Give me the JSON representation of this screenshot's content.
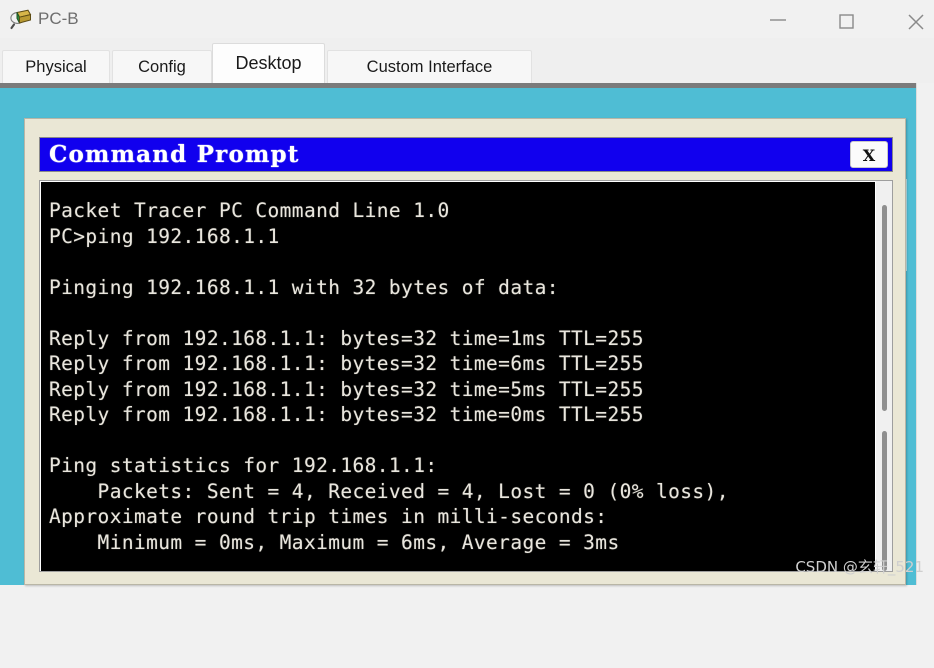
{
  "window": {
    "title": "PC-B",
    "icon": "packet-tracer-pc-icon",
    "controls": {
      "minimize_label": "—",
      "maximize_label": "□",
      "close_label": "✕"
    }
  },
  "tabs": [
    {
      "label": "Physical",
      "active": false
    },
    {
      "label": "Config",
      "active": false
    },
    {
      "label": "Desktop",
      "active": true
    },
    {
      "label": "Custom Interface",
      "active": false
    }
  ],
  "desktop": {
    "background_color": "#4fbdd4",
    "tiles": [
      {
        "icon": "ip-configuration-icon"
      },
      {
        "icon": "dial-up-icon"
      },
      {
        "icon": "terminal-icon"
      },
      {
        "icon": "command-prompt-icon"
      },
      {
        "icon": "web-browser-icon"
      }
    ]
  },
  "command_prompt": {
    "title": "Command Prompt",
    "title_bar_color": "#1100ee",
    "close_button_label": "X",
    "terminal": {
      "background_color": "#000000",
      "text_color": "#e9e6de",
      "lines": [
        "Packet Tracer PC Command Line 1.0",
        "PC>ping 192.168.1.1",
        "",
        "Pinging 192.168.1.1 with 32 bytes of data:",
        "",
        "Reply from 192.168.1.1: bytes=32 time=1ms TTL=255",
        "Reply from 192.168.1.1: bytes=32 time=6ms TTL=255",
        "Reply from 192.168.1.1: bytes=32 time=5ms TTL=255",
        "Reply from 192.168.1.1: bytes=32 time=0ms TTL=255",
        "",
        "Ping statistics for 192.168.1.1:",
        "    Packets: Sent = 4, Received = 4, Lost = 0 (0% loss),",
        "Approximate round trip times in milli-seconds:",
        "    Minimum = 0ms, Maximum = 6ms, Average = 3ms"
      ],
      "ping_summary": {
        "target": "192.168.1.1",
        "bytes": 32,
        "sent": 4,
        "received": 4,
        "lost": 0,
        "loss_percent": 0,
        "minimum_ms": 0,
        "maximum_ms": 6,
        "average_ms": 3,
        "ttl": 255,
        "reply_times_ms": [
          1,
          6,
          5,
          0
        ]
      }
    }
  },
  "watermark": "CSDN @玄轩_521"
}
